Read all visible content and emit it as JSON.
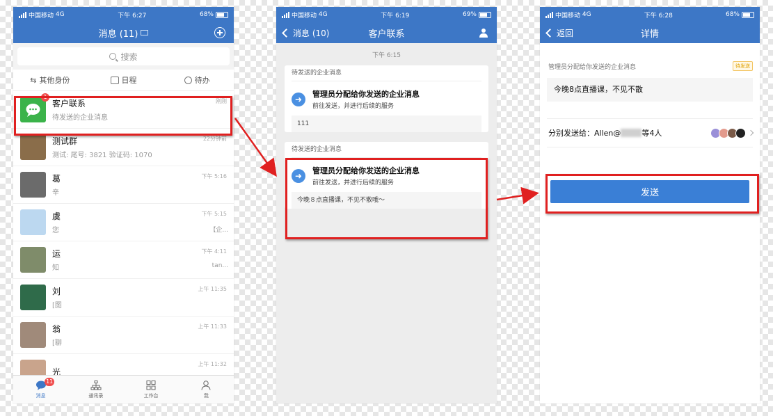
{
  "status_bars": [
    {
      "carrier": "中国移动",
      "network": "4G",
      "time": "下午 6:27",
      "battery": "68%"
    },
    {
      "carrier": "中国移动",
      "network": "4G",
      "time": "下午 6:19",
      "battery": "69%"
    },
    {
      "carrier": "中国移动",
      "network": "4G",
      "time": "下午 6:28",
      "battery": "68%"
    }
  ],
  "phone1": {
    "title": "消息 (11)",
    "search_placeholder": "搜索",
    "quick": [
      {
        "label": "其他身份"
      },
      {
        "label": "日程"
      },
      {
        "label": "待办"
      }
    ],
    "messages": [
      {
        "name": "客户联系",
        "preview": "待发送的企业消息",
        "time": "刚刚",
        "badge": "1",
        "color": "#3bb34a"
      },
      {
        "name": "测试群",
        "preview": "测试: 尾号: 3821 验证码: 1070",
        "time": "22分钟前",
        "color": "#8a6d4a"
      },
      {
        "name": "葛",
        "preview": "辛",
        "time": "下午 5:16",
        "color": "#6b6b6b"
      },
      {
        "name": "虞",
        "preview": "您",
        "trailing": "【企...",
        "time": "下午 5:15",
        "color": "#bcd8f0"
      },
      {
        "name": "运",
        "preview": "知",
        "trailing": "tan...",
        "time": "下午 4:11",
        "color": "#7f8c6a"
      },
      {
        "name": "刘",
        "preview": "[图",
        "time": "上午 11:35",
        "color": "#2f6b4a"
      },
      {
        "name": "翁",
        "preview": "[聊",
        "time": "上午 11:33",
        "color": "#a08a7a"
      },
      {
        "name": "光",
        "preview": "",
        "time": "上午 11:32",
        "color": "#c9a48c"
      }
    ],
    "tabs": [
      {
        "label": "消息",
        "badge": "11"
      },
      {
        "label": "通讯录"
      },
      {
        "label": "工作台"
      },
      {
        "label": "我"
      }
    ]
  },
  "phone2": {
    "back": "消息 (10)",
    "title": "客户联系",
    "timestamp": "下午 6:15",
    "cards": [
      {
        "header": "待发送的企业消息",
        "title": "管理员分配给你发送的企业消息",
        "subtitle": "前往发送，并进行后续的服务",
        "note": "111"
      },
      {
        "header": "待发送的企业消息",
        "title": "管理员分配给你发送的企业消息",
        "subtitle": "前往发送，并进行后续的服务",
        "note": "今晚８点直播课，不见不散哦～"
      }
    ]
  },
  "phone3": {
    "back": "返回",
    "title": "详情",
    "label": "管理员分配给你发送的企业消息",
    "status": "待发送",
    "content": "今晚8点直播课，不见不散",
    "recipients_prefix": "分别发送给：Allen@",
    "recipients_suffix": "等4人",
    "send": "发送"
  },
  "colors": {
    "brand": "#3d77c6",
    "highlight": "#e02020",
    "send_button": "#3a7fd6",
    "badge": "#f04b4b"
  }
}
